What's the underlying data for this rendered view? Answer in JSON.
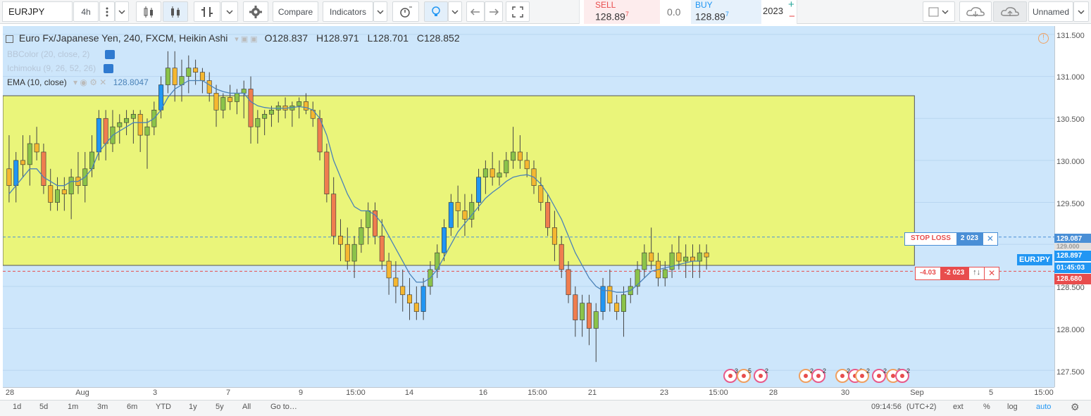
{
  "toolbar": {
    "symbol": "EURJPY",
    "interval": "4h",
    "compare_label": "Compare",
    "indicators_label": "Indicators",
    "layout_name": "Unnamed"
  },
  "trade": {
    "sell_label": "SELL",
    "sell_price": "128.89",
    "sell_sup": "7",
    "spread": "0.0",
    "buy_label": "BUY",
    "buy_price": "128.89",
    "buy_sup": "7",
    "quantity": "2023",
    "plus": "+",
    "minus": "−"
  },
  "legend": {
    "title": "Euro Fx/Japanese Yen, 240, FXCM, Heikin Ashi",
    "open": "O128.837",
    "high": "H128.971",
    "low": "L128.701",
    "close": "C128.852"
  },
  "indicators": [
    {
      "label": "BBColor (20, close, 2)",
      "value": ""
    },
    {
      "label": "Ichimoku (9, 26, 52, 26)",
      "value": ""
    },
    {
      "label": "EMA (10, close)",
      "value": "128.8047"
    }
  ],
  "price_axis": {
    "ticks": [
      "131.500",
      "131.000",
      "130.500",
      "130.000",
      "129.500",
      "129.000",
      "128.500",
      "128.000",
      "127.500"
    ],
    "stop_loss_price": "129.087",
    "hidden_price": "129.000",
    "last_price": "128.897",
    "countdown": "01:45:03",
    "entry_price": "128.680"
  },
  "time_axis": {
    "ticks": [
      "28",
      "Aug",
      "3",
      "7",
      "9",
      "15:00",
      "14",
      "16",
      "15:00",
      "21",
      "23",
      "15:00",
      "28",
      "30",
      "Sep",
      "5",
      "15:00"
    ]
  },
  "orders": {
    "stop_loss_label": "STOP LOSS",
    "stop_loss_qty": "2 023",
    "pnl": "-4.03",
    "position_qty": "-2 023",
    "symbol_tag": "EURJPY",
    "reverse_icon": "↑↓",
    "close_icon": "✕"
  },
  "events": [
    "3",
    "5",
    "2",
    "2",
    "2",
    "2",
    "2",
    "2",
    "2",
    "3",
    "2"
  ],
  "bottombar": {
    "ranges": [
      "1d",
      "5d",
      "1m",
      "3m",
      "6m",
      "YTD",
      "1y",
      "5y",
      "All"
    ],
    "goto_label": "Go to…",
    "clock": "09:14:56",
    "timezone": "(UTC+2)",
    "ext": "ext",
    "percent": "%",
    "log": "log",
    "auto": "auto"
  },
  "colors": {
    "chart_bg": "#cde6fb",
    "zone_fill": "#eaf57a",
    "bull": "#8bc34a",
    "bear": "#f5b731",
    "strong_bull": "#2196f3",
    "strong_bear": "#ef7d4f",
    "ema": "#4a82b8",
    "stop_line": "#4a8fd6",
    "entry_line": "#e84d4d"
  },
  "chart_data": {
    "type": "candlestick",
    "title": "Euro Fx/Japanese Yen, 240, FXCM, Heikin Ashi",
    "ylim": [
      127.3,
      131.6
    ],
    "x_range": [
      0,
      248
    ],
    "zone": {
      "x_start": 0,
      "x_end": 215,
      "y_top": 130.77,
      "y_bottom": 128.75
    },
    "stop_loss": 129.087,
    "entry": 128.68,
    "candles": [
      {
        "o": 129.9,
        "h": 130.3,
        "l": 129.5,
        "c": 129.7
      },
      {
        "o": 129.7,
        "h": 130.1,
        "l": 129.5,
        "c": 130.0
      },
      {
        "o": 130.0,
        "h": 130.3,
        "l": 129.8,
        "c": 129.95
      },
      {
        "o": 129.95,
        "h": 130.3,
        "l": 129.7,
        "c": 130.2
      },
      {
        "o": 130.2,
        "h": 130.4,
        "l": 130.0,
        "c": 130.1
      },
      {
        "o": 130.1,
        "h": 130.2,
        "l": 129.6,
        "c": 129.7
      },
      {
        "o": 129.7,
        "h": 129.9,
        "l": 129.4,
        "c": 129.5
      },
      {
        "o": 129.5,
        "h": 129.8,
        "l": 129.4,
        "c": 129.65
      },
      {
        "o": 129.65,
        "h": 129.8,
        "l": 129.4,
        "c": 129.6
      },
      {
        "o": 129.6,
        "h": 129.9,
        "l": 129.3,
        "c": 129.8
      },
      {
        "o": 129.8,
        "h": 130.1,
        "l": 129.6,
        "c": 129.7
      },
      {
        "o": 129.7,
        "h": 130.1,
        "l": 129.5,
        "c": 129.9
      },
      {
        "o": 129.9,
        "h": 130.3,
        "l": 129.8,
        "c": 130.1
      },
      {
        "o": 130.1,
        "h": 130.6,
        "l": 130.0,
        "c": 130.5
      },
      {
        "o": 130.5,
        "h": 130.6,
        "l": 130.0,
        "c": 130.2
      },
      {
        "o": 130.2,
        "h": 130.6,
        "l": 130.1,
        "c": 130.4
      },
      {
        "o": 130.4,
        "h": 130.55,
        "l": 130.2,
        "c": 130.45
      },
      {
        "o": 130.45,
        "h": 130.6,
        "l": 130.3,
        "c": 130.5
      },
      {
        "o": 130.5,
        "h": 130.6,
        "l": 130.2,
        "c": 130.55
      },
      {
        "o": 130.55,
        "h": 130.6,
        "l": 130.1,
        "c": 130.3
      },
      {
        "o": 130.3,
        "h": 130.5,
        "l": 129.9,
        "c": 130.4
      },
      {
        "o": 130.4,
        "h": 130.7,
        "l": 130.3,
        "c": 130.6
      },
      {
        "o": 130.6,
        "h": 131.0,
        "l": 130.5,
        "c": 130.9
      },
      {
        "o": 130.9,
        "h": 131.3,
        "l": 130.8,
        "c": 131.1
      },
      {
        "o": 131.1,
        "h": 131.3,
        "l": 130.7,
        "c": 130.9
      },
      {
        "o": 130.9,
        "h": 131.2,
        "l": 130.7,
        "c": 131.0
      },
      {
        "o": 131.0,
        "h": 131.25,
        "l": 130.8,
        "c": 131.1
      },
      {
        "o": 131.1,
        "h": 131.2,
        "l": 130.9,
        "c": 131.05
      },
      {
        "o": 131.05,
        "h": 131.1,
        "l": 130.8,
        "c": 130.95
      },
      {
        "o": 130.95,
        "h": 131.05,
        "l": 130.7,
        "c": 130.8
      },
      {
        "o": 130.8,
        "h": 130.9,
        "l": 130.4,
        "c": 130.6
      },
      {
        "o": 130.6,
        "h": 130.8,
        "l": 130.5,
        "c": 130.75
      },
      {
        "o": 130.75,
        "h": 130.9,
        "l": 130.6,
        "c": 130.7
      },
      {
        "o": 130.7,
        "h": 130.85,
        "l": 130.55,
        "c": 130.8
      },
      {
        "o": 130.8,
        "h": 130.95,
        "l": 130.5,
        "c": 130.85
      },
      {
        "o": 130.85,
        "h": 131.0,
        "l": 130.2,
        "c": 130.4
      },
      {
        "o": 130.4,
        "h": 130.6,
        "l": 130.2,
        "c": 130.5
      },
      {
        "o": 130.5,
        "h": 130.6,
        "l": 130.3,
        "c": 130.55
      },
      {
        "o": 130.55,
        "h": 130.65,
        "l": 130.4,
        "c": 130.6
      },
      {
        "o": 130.6,
        "h": 130.7,
        "l": 130.45,
        "c": 130.65
      },
      {
        "o": 130.65,
        "h": 130.75,
        "l": 130.5,
        "c": 130.6
      },
      {
        "o": 130.6,
        "h": 130.7,
        "l": 130.4,
        "c": 130.65
      },
      {
        "o": 130.65,
        "h": 130.75,
        "l": 130.5,
        "c": 130.7
      },
      {
        "o": 130.7,
        "h": 130.8,
        "l": 130.55,
        "c": 130.6
      },
      {
        "o": 130.6,
        "h": 130.7,
        "l": 130.4,
        "c": 130.5
      },
      {
        "o": 130.5,
        "h": 130.6,
        "l": 130.0,
        "c": 130.1
      },
      {
        "o": 130.1,
        "h": 130.2,
        "l": 129.5,
        "c": 129.6
      },
      {
        "o": 129.6,
        "h": 129.8,
        "l": 129.0,
        "c": 129.1
      },
      {
        "o": 129.1,
        "h": 129.3,
        "l": 128.8,
        "c": 129.0
      },
      {
        "o": 129.0,
        "h": 129.2,
        "l": 128.7,
        "c": 128.8
      },
      {
        "o": 128.8,
        "h": 129.1,
        "l": 128.6,
        "c": 129.0
      },
      {
        "o": 129.0,
        "h": 129.3,
        "l": 128.9,
        "c": 129.2
      },
      {
        "o": 129.2,
        "h": 129.5,
        "l": 129.0,
        "c": 129.4
      },
      {
        "o": 129.4,
        "h": 129.5,
        "l": 129.0,
        "c": 129.1
      },
      {
        "o": 129.1,
        "h": 129.3,
        "l": 128.7,
        "c": 128.8
      },
      {
        "o": 128.8,
        "h": 128.9,
        "l": 128.4,
        "c": 128.6
      },
      {
        "o": 128.6,
        "h": 128.8,
        "l": 128.3,
        "c": 128.5
      },
      {
        "o": 128.5,
        "h": 128.7,
        "l": 128.2,
        "c": 128.4
      },
      {
        "o": 128.4,
        "h": 128.6,
        "l": 128.1,
        "c": 128.3
      },
      {
        "o": 128.3,
        "h": 128.5,
        "l": 128.1,
        "c": 128.2
      },
      {
        "o": 128.2,
        "h": 128.6,
        "l": 128.1,
        "c": 128.5
      },
      {
        "o": 128.5,
        "h": 128.8,
        "l": 128.4,
        "c": 128.7
      },
      {
        "o": 128.7,
        "h": 129.0,
        "l": 128.6,
        "c": 128.9
      },
      {
        "o": 128.9,
        "h": 129.3,
        "l": 128.8,
        "c": 129.2
      },
      {
        "o": 129.2,
        "h": 129.6,
        "l": 129.1,
        "c": 129.5
      },
      {
        "o": 129.5,
        "h": 129.7,
        "l": 129.2,
        "c": 129.4
      },
      {
        "o": 129.4,
        "h": 129.6,
        "l": 129.1,
        "c": 129.3
      },
      {
        "o": 129.3,
        "h": 129.6,
        "l": 129.2,
        "c": 129.5
      },
      {
        "o": 129.5,
        "h": 129.9,
        "l": 129.4,
        "c": 129.8
      },
      {
        "o": 129.8,
        "h": 130.0,
        "l": 129.6,
        "c": 129.9
      },
      {
        "o": 129.9,
        "h": 130.1,
        "l": 129.7,
        "c": 129.8
      },
      {
        "o": 129.8,
        "h": 130.0,
        "l": 129.7,
        "c": 129.85
      },
      {
        "o": 129.85,
        "h": 130.1,
        "l": 129.8,
        "c": 130.0
      },
      {
        "o": 130.0,
        "h": 130.4,
        "l": 129.9,
        "c": 130.1
      },
      {
        "o": 130.1,
        "h": 130.3,
        "l": 129.9,
        "c": 130.0
      },
      {
        "o": 130.0,
        "h": 130.1,
        "l": 129.8,
        "c": 129.9
      },
      {
        "o": 129.9,
        "h": 130.0,
        "l": 129.6,
        "c": 129.7
      },
      {
        "o": 129.7,
        "h": 129.8,
        "l": 129.4,
        "c": 129.5
      },
      {
        "o": 129.5,
        "h": 129.6,
        "l": 129.1,
        "c": 129.2
      },
      {
        "o": 129.2,
        "h": 129.4,
        "l": 128.8,
        "c": 129.0
      },
      {
        "o": 129.0,
        "h": 129.1,
        "l": 128.6,
        "c": 128.7
      },
      {
        "o": 128.7,
        "h": 128.8,
        "l": 128.3,
        "c": 128.4
      },
      {
        "o": 128.4,
        "h": 128.5,
        "l": 127.9,
        "c": 128.1
      },
      {
        "o": 128.1,
        "h": 128.4,
        "l": 127.9,
        "c": 128.3
      },
      {
        "o": 128.3,
        "h": 128.4,
        "l": 127.8,
        "c": 128.0
      },
      {
        "o": 128.0,
        "h": 128.3,
        "l": 127.6,
        "c": 128.2
      },
      {
        "o": 128.2,
        "h": 128.6,
        "l": 128.1,
        "c": 128.5
      },
      {
        "o": 128.5,
        "h": 128.7,
        "l": 128.2,
        "c": 128.3
      },
      {
        "o": 128.3,
        "h": 128.4,
        "l": 128.1,
        "c": 128.2
      },
      {
        "o": 128.2,
        "h": 128.5,
        "l": 127.9,
        "c": 128.4
      },
      {
        "o": 128.4,
        "h": 128.6,
        "l": 128.3,
        "c": 128.5
      },
      {
        "o": 128.5,
        "h": 128.8,
        "l": 128.4,
        "c": 128.7
      },
      {
        "o": 128.7,
        "h": 129.0,
        "l": 128.6,
        "c": 128.9
      },
      {
        "o": 128.9,
        "h": 129.2,
        "l": 128.7,
        "c": 128.8
      },
      {
        "o": 128.8,
        "h": 128.9,
        "l": 128.5,
        "c": 128.6
      },
      {
        "o": 128.6,
        "h": 128.8,
        "l": 128.5,
        "c": 128.7
      },
      {
        "o": 128.7,
        "h": 129.0,
        "l": 128.6,
        "c": 128.9
      },
      {
        "o": 128.9,
        "h": 129.1,
        "l": 128.7,
        "c": 128.8
      },
      {
        "o": 128.8,
        "h": 129.0,
        "l": 128.6,
        "c": 128.85
      },
      {
        "o": 128.85,
        "h": 129.0,
        "l": 128.6,
        "c": 128.8
      },
      {
        "o": 128.8,
        "h": 129.0,
        "l": 128.6,
        "c": 128.9
      },
      {
        "o": 128.9,
        "h": 129.0,
        "l": 128.7,
        "c": 128.85
      }
    ],
    "ema": [
      129.6,
      129.7,
      129.8,
      129.9,
      129.9,
      129.8,
      129.75,
      129.7,
      129.7,
      129.75,
      129.75,
      129.8,
      129.9,
      130.1,
      130.2,
      130.3,
      130.35,
      130.4,
      130.45,
      130.45,
      130.45,
      130.5,
      130.6,
      130.75,
      130.85,
      130.9,
      130.95,
      130.95,
      130.95,
      130.9,
      130.85,
      130.82,
      130.8,
      130.8,
      130.8,
      130.7,
      130.65,
      130.63,
      130.62,
      130.62,
      130.62,
      130.63,
      130.64,
      130.63,
      130.6,
      130.5,
      130.3,
      130.0,
      129.8,
      129.6,
      129.45,
      129.4,
      129.4,
      129.35,
      129.25,
      129.1,
      128.95,
      128.8,
      128.65,
      128.55,
      128.55,
      128.6,
      128.7,
      128.85,
      129.0,
      129.15,
      129.25,
      129.35,
      129.45,
      129.55,
      129.62,
      129.68,
      129.75,
      129.8,
      129.82,
      129.83,
      129.8,
      129.72,
      129.6,
      129.45,
      129.3,
      129.1,
      128.9,
      128.75,
      128.6,
      128.5,
      128.45,
      128.45,
      128.43,
      128.43,
      128.45,
      128.52,
      128.6,
      128.68,
      128.7,
      128.72,
      128.74,
      128.76,
      128.78,
      128.8,
      128.8
    ]
  }
}
